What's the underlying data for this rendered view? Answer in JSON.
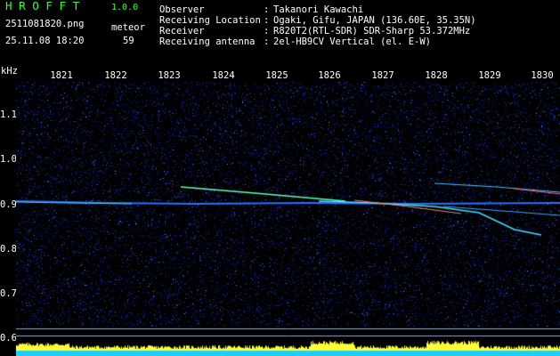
{
  "header": {
    "app_name": "HROFFT",
    "version": "1.0.0",
    "filename": "2511081820.png",
    "meteor_label": "meteor",
    "datetime": "25.11.08 18:20",
    "meteor_count": "59"
  },
  "info": [
    {
      "key": "Observer",
      "sep": ":",
      "value": "Takanori Kawachi"
    },
    {
      "key": "Receiving Location",
      "sep": ":",
      "value": "Ogaki, Gifu, JAPAN (136.60E, 35.35N)"
    },
    {
      "key": "Receiver",
      "sep": ":",
      "value": "R820T2(RTL-SDR) SDR-Sharp 53.372MHz"
    },
    {
      "key": "Receiving antenna",
      "sep": ":",
      "value": "2el-HB9CV Vertical (el. E-W)"
    }
  ],
  "axis": {
    "unit": "kHz",
    "time_labels": [
      "1821",
      "1822",
      "1823",
      "1824",
      "1825",
      "1826",
      "1827",
      "1828",
      "1829",
      "1830"
    ],
    "freq_labels": [
      "1.1",
      "1.0",
      "0.9",
      "0.8",
      "0.7",
      "0.6"
    ]
  },
  "colors": {
    "title_green": "#33ff33",
    "background": "#000000",
    "noise_blue": "#0c1fa8",
    "trace_cyan": "#33ccff",
    "bottom_yellow": "#ffff33",
    "bottom_cyan": "#22ccff"
  }
}
